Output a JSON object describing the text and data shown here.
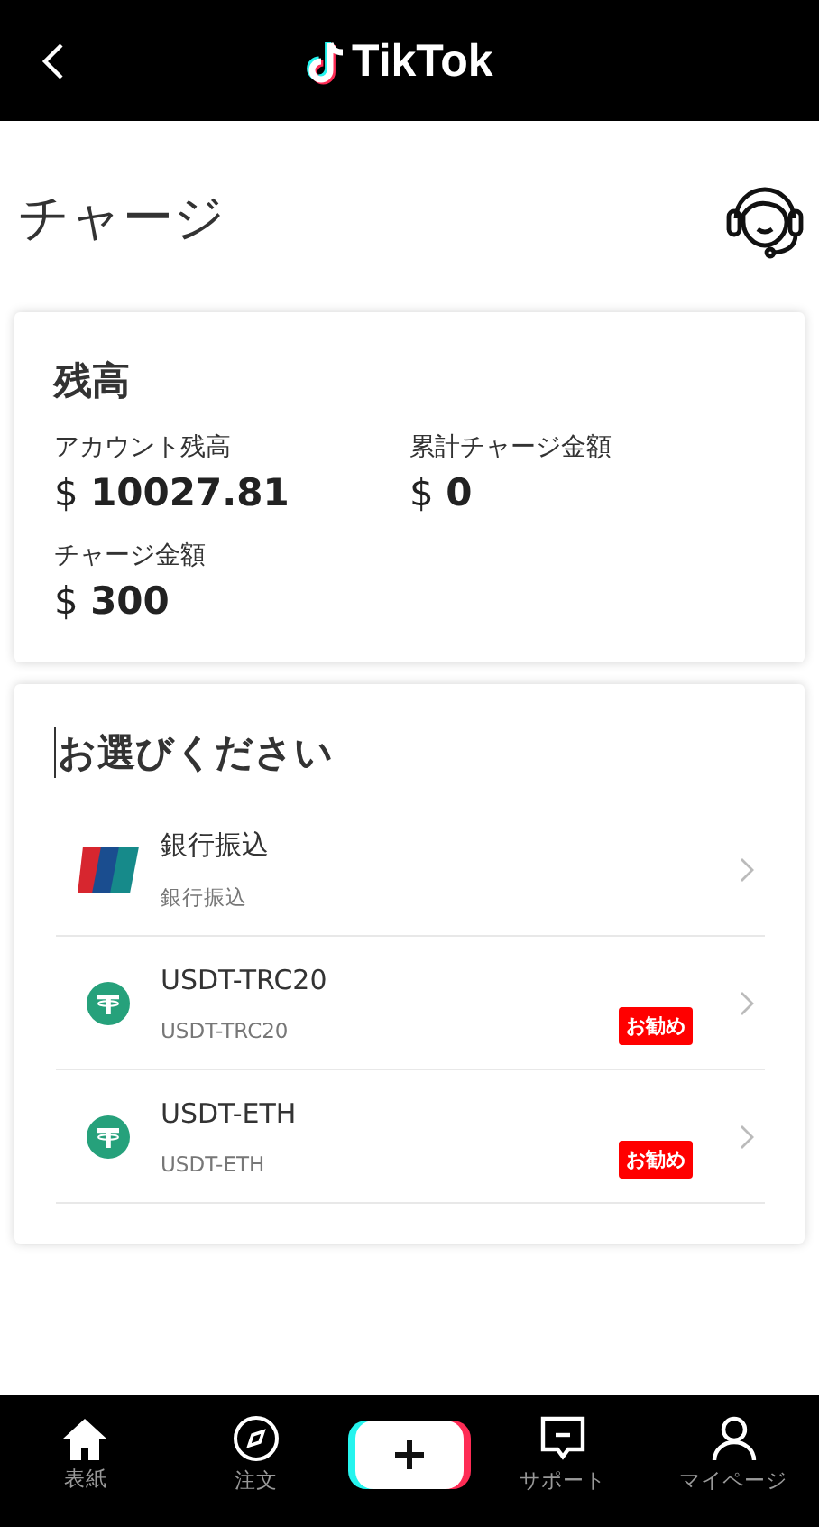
{
  "header": {
    "brand": "TikTok"
  },
  "page_title": "チャージ",
  "balance_card": {
    "title": "残高",
    "fields": [
      {
        "label": "アカウント残高",
        "currency": "$",
        "value": "10027.81"
      },
      {
        "label": "累計チャージ金額",
        "currency": "$",
        "value": "0"
      },
      {
        "label": "チャージ金額",
        "currency": "$",
        "value": "300"
      }
    ]
  },
  "methods_card": {
    "title": "お選びください",
    "methods": [
      {
        "kind": "bank",
        "name": "銀行振込",
        "subtitle": "銀行振込"
      },
      {
        "kind": "usdt",
        "name": "USDT-TRC20",
        "subtitle": "USDT-TRC20",
        "badge": "お勧め"
      },
      {
        "kind": "usdt",
        "name": "USDT-ETH",
        "subtitle": "USDT-ETH",
        "badge": "お勧め"
      }
    ]
  },
  "bottom_nav": [
    {
      "kind": "home",
      "label": "表紙"
    },
    {
      "kind": "compass",
      "label": "注文"
    },
    {
      "kind": "plus"
    },
    {
      "kind": "support",
      "label": "サポート"
    },
    {
      "kind": "profile",
      "label": "マイページ"
    }
  ]
}
